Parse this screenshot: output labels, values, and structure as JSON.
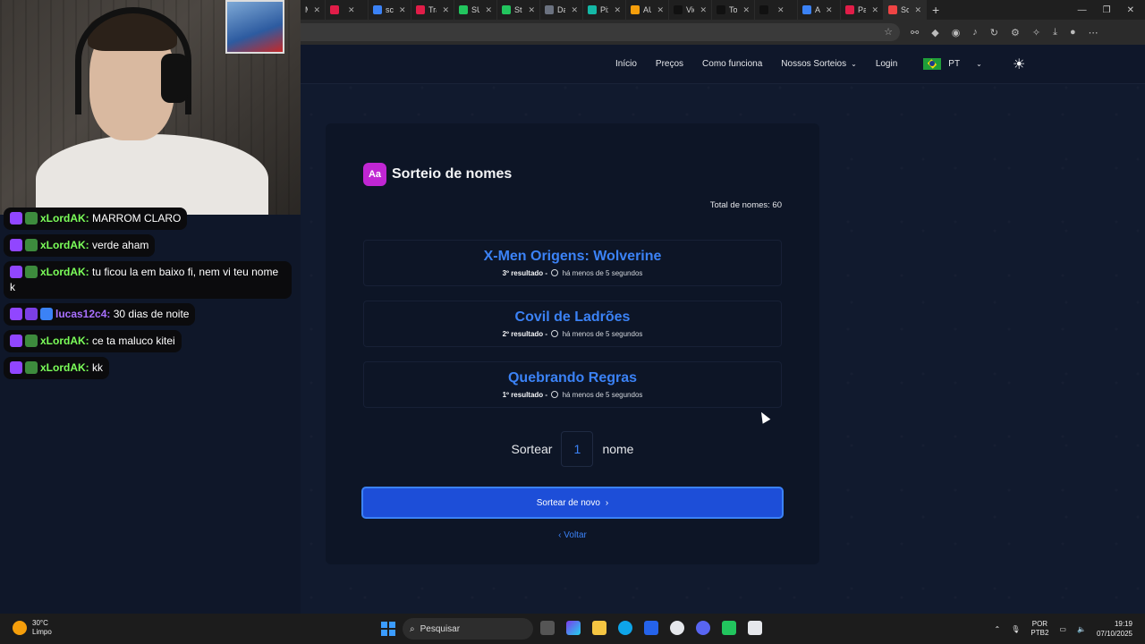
{
  "browser": {
    "tabs": [
      {
        "label": "M",
        "color": "#7c3aed"
      },
      {
        "label": "",
        "color": "#e11d48"
      },
      {
        "label": "sc",
        "color": "#3b82f6"
      },
      {
        "label": "Transm",
        "color": "#e11d48"
      },
      {
        "label": "SUPER",
        "color": "#22c55e"
      },
      {
        "label": "Stream",
        "color": "#22c55e"
      },
      {
        "label": "Dashb",
        "color": "#6b7280"
      },
      {
        "label": "PixGG",
        "color": "#14b8a6"
      },
      {
        "label": "AURA",
        "color": "#f59e0b"
      },
      {
        "label": "Video",
        "color": "#111111"
      },
      {
        "label": "Tornar",
        "color": "#111111"
      },
      {
        "label": "",
        "color": "#111111"
      },
      {
        "label": "A",
        "color": "#3b82f6"
      },
      {
        "label": "Painel",
        "color": "#e11d48"
      },
      {
        "label": "Sortei",
        "color": "#ef4444"
      }
    ],
    "new_tab": "+",
    "window_controls": [
      "—",
      "❐",
      "✕"
    ],
    "toolbar_icons": [
      "☆",
      "⚯",
      "◆",
      "◉",
      "♪",
      "↻",
      "⚙",
      "✧",
      "⤓",
      "●",
      "⋯"
    ]
  },
  "site": {
    "nav": {
      "inicio": "Início",
      "precos": "Preços",
      "como_funciona": "Como funciona",
      "nossos_sorteios": "Nossos Sorteios",
      "login": "Login",
      "lang": "PT"
    },
    "card": {
      "icon_label": "Aa",
      "title": "Sorteio de nomes",
      "total": "Total de nomes: 60",
      "results": [
        {
          "name": "X-Men Origens: Wolverine",
          "rank": "3º resultado -",
          "time": "há menos de 5 segundos"
        },
        {
          "name": "Covil de Ladrões",
          "rank": "2º resultado -",
          "time": "há menos de 5 segundos"
        },
        {
          "name": "Quebrando Regras",
          "rank": "1º resultado -",
          "time": "há menos de 5 segundos"
        }
      ],
      "sortear_label": "Sortear",
      "quantity": "1",
      "nome_label": "nome",
      "again_button": "Sortear de novo",
      "back_link": "Voltar"
    }
  },
  "chat": {
    "messages": [
      {
        "user": "xLordAK:",
        "text": "MARROM CLARO",
        "badges": [
          "twitch",
          "green"
        ],
        "user_color": "green"
      },
      {
        "user": "xLordAK:",
        "text": "verde aham",
        "badges": [
          "twitch",
          "green"
        ],
        "user_color": "green"
      },
      {
        "user": "xLordAK:",
        "text": "tu ficou la em baixo fi, nem vi teu nome k",
        "badges": [
          "twitch",
          "green"
        ],
        "user_color": "green"
      },
      {
        "user": "lucas12c4:",
        "text": "30 dias de noite",
        "badges": [
          "twitch",
          "sub",
          "crown"
        ],
        "user_color": "purple"
      },
      {
        "user": "xLordAK:",
        "text": "ce ta maluco kitei",
        "badges": [
          "twitch",
          "green"
        ],
        "user_color": "green"
      },
      {
        "user": "xLordAK:",
        "text": "kk",
        "badges": [
          "twitch",
          "green"
        ],
        "user_color": "green"
      }
    ]
  },
  "taskbar": {
    "weather_temp": "30°C",
    "weather_desc": "Limpo",
    "search_placeholder": "Pesquisar",
    "lang_top": "POR",
    "lang_bottom": "PTB2",
    "time": "19:19",
    "date": "07/10/2025"
  }
}
